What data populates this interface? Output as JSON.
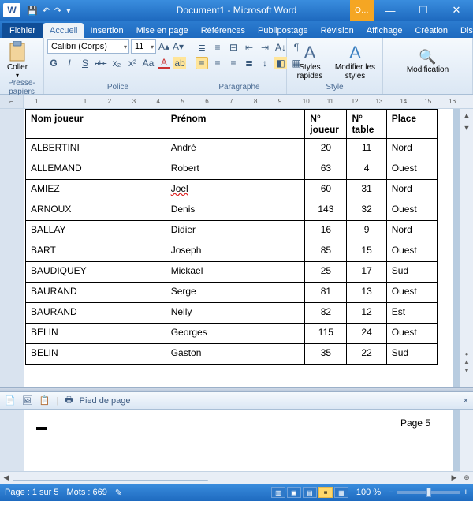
{
  "titlebar": {
    "app_icon": "W",
    "title": "Document1 - Microsoft Word",
    "user_badge": "O…",
    "min": "—",
    "max": "☐",
    "close": "✕"
  },
  "tabs": {
    "fichier": "Fichier",
    "items": [
      "Accueil",
      "Insertion",
      "Mise en page",
      "Références",
      "Publipostage",
      "Révision",
      "Affichage",
      "Création",
      "Disposition"
    ],
    "active_index": 0,
    "help_up": "⌃",
    "help_q": "?"
  },
  "ribbon": {
    "clipboard": {
      "paste": "Coller",
      "label": "Presse-papiers"
    },
    "font": {
      "name": "Calibri (Corps)",
      "size": "11",
      "label": "Police"
    },
    "glyphs": {
      "B": "G",
      "I": "I",
      "U": "S",
      "strike": "abc",
      "sub": "x₂",
      "sup": "x²",
      "grow": "A▴",
      "shrink": "A▾",
      "clear": "⌫",
      "case": "Aa",
      "hl": "ab",
      "color": "A"
    },
    "paragraph": {
      "label": "Paragraphe"
    },
    "styles": {
      "quick": "Styles rapides",
      "modify": "Modifier les styles",
      "label": "Style"
    },
    "editing": {
      "label": "Modification"
    }
  },
  "ruler": {
    "marks": [
      "1",
      "",
      "1",
      "2",
      "3",
      "4",
      "5",
      "6",
      "7",
      "8",
      "9",
      "10",
      "11",
      "12",
      "13",
      "14",
      "15",
      "16"
    ]
  },
  "table": {
    "headers": [
      "Nom joueur",
      "Prénom",
      "N° joueur",
      "N° table",
      "Place"
    ],
    "rows": [
      {
        "nom": "ALBERTINI",
        "prenom": "André",
        "nj": "20",
        "nt": "11",
        "place": "Nord"
      },
      {
        "nom": "ALLEMAND",
        "prenom": "Robert",
        "nj": "63",
        "nt": "4",
        "place": "Ouest"
      },
      {
        "nom": "AMIEZ",
        "prenom": "Joel",
        "nj": "60",
        "nt": "31",
        "place": "Nord",
        "spell": true
      },
      {
        "nom": "ARNOUX",
        "prenom": "Denis",
        "nj": "143",
        "nt": "32",
        "place": "Ouest"
      },
      {
        "nom": "BALLAY",
        "prenom": "Didier",
        "nj": "16",
        "nt": "9",
        "place": "Nord"
      },
      {
        "nom": "BART",
        "prenom": "Joseph",
        "nj": "85",
        "nt": "15",
        "place": "Ouest"
      },
      {
        "nom": "BAUDIQUEY",
        "prenom": "Mickael",
        "nj": "25",
        "nt": "17",
        "place": "Sud"
      },
      {
        "nom": "BAURAND",
        "prenom": "Serge",
        "nj": "81",
        "nt": "13",
        "place": "Ouest"
      },
      {
        "nom": "BAURAND",
        "prenom": "Nelly",
        "nj": "82",
        "nt": "12",
        "place": "Est"
      },
      {
        "nom": "BELIN",
        "prenom": "Georges",
        "nj": "115",
        "nt": "24",
        "place": "Ouest"
      },
      {
        "nom": "BELIN",
        "prenom": "Gaston",
        "nj": "35",
        "nt": "22",
        "place": "Sud"
      }
    ]
  },
  "footer_pane": {
    "label": "Pied de page",
    "page_label": "Page 5"
  },
  "status": {
    "page": "Page : 1 sur 5",
    "words": "Mots : 669",
    "zoom": "100 %",
    "minus": "−",
    "plus": "+"
  },
  "chart_data": {
    "type": "table",
    "title": "",
    "columns": [
      "Nom joueur",
      "Prénom",
      "N° joueur",
      "N° table",
      "Place"
    ],
    "rows": [
      [
        "ALBERTINI",
        "André",
        20,
        11,
        "Nord"
      ],
      [
        "ALLEMAND",
        "Robert",
        63,
        4,
        "Ouest"
      ],
      [
        "AMIEZ",
        "Joel",
        60,
        31,
        "Nord"
      ],
      [
        "ARNOUX",
        "Denis",
        143,
        32,
        "Ouest"
      ],
      [
        "BALLAY",
        "Didier",
        16,
        9,
        "Nord"
      ],
      [
        "BART",
        "Joseph",
        85,
        15,
        "Ouest"
      ],
      [
        "BAUDIQUEY",
        "Mickael",
        25,
        17,
        "Sud"
      ],
      [
        "BAURAND",
        "Serge",
        81,
        13,
        "Ouest"
      ],
      [
        "BAURAND",
        "Nelly",
        82,
        12,
        "Est"
      ],
      [
        "BELIN",
        "Georges",
        115,
        24,
        "Ouest"
      ],
      [
        "BELIN",
        "Gaston",
        35,
        22,
        "Sud"
      ]
    ]
  }
}
